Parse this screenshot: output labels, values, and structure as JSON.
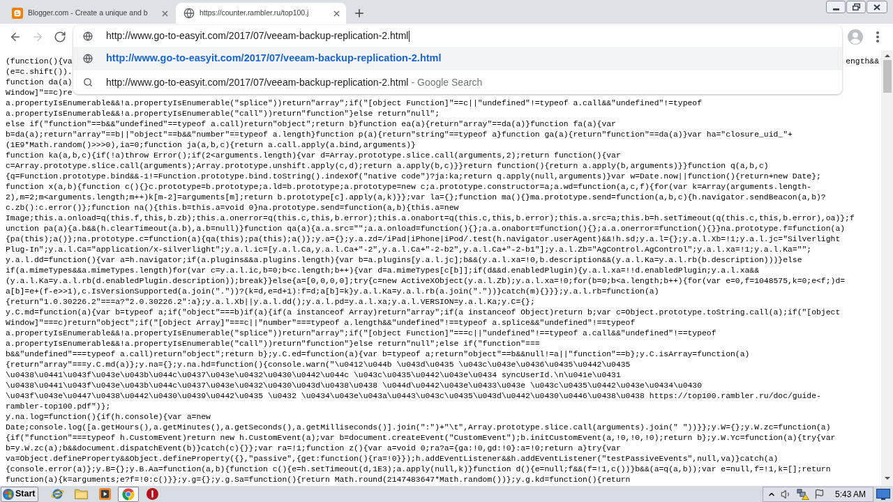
{
  "tabs": [
    {
      "kind": "blog",
      "title": "Blogger.com - Create a unique and b",
      "selected": false
    },
    {
      "kind": "page",
      "title": "https://counter.rambler.ru/top100.j",
      "selected": true
    }
  ],
  "toolbar": {
    "nav": [
      {
        "kind": "back",
        "disabled": false
      },
      {
        "kind": "forward",
        "disabled": true
      },
      {
        "kind": "reload",
        "disabled": false
      }
    ],
    "omnibox": {
      "value": "http://www.go-to-easyit.com/2017/07/veeam-backup-replication-2.html"
    },
    "suggestions": [
      {
        "kind": "url",
        "text": "http://www.go-to-easyit.com/2017/07/veeam-backup-replication-2.html",
        "selected": true
      },
      {
        "kind": "search",
        "text": "http://www.go-to-easyit.com/2017/07/veeam-backup-replication-2.html",
        "suffix": "- Google Search",
        "selected": false
      }
    ]
  },
  "document": {
    "covered_lines": [
      {
        "start": "(function(){va",
        "end": "ength&&"
      },
      {
        "start": "(e=c.shift())."
      },
      {
        "start": "function da(a)"
      },
      {
        "start": "Window]\"==c)re"
      }
    ],
    "lines": [
      "a.propertyIsEnumerable&&!a.propertyIsEnumerable(\"splice\"))return\"array\";if(\"[object Function]\"==c||\"undefined\"!=typeof a.call&&\"undefined\"!=typeof",
      "a.propertyIsEnumerable&&!a.propertyIsEnumerable(\"call\"))return\"function\"}else return\"null\";",
      "else if(\"function\"==b&&\"undefined\"==typeof a.call)return\"object\";return b}function ea(a){return\"array\"==da(a)}function fa(a){var",
      "b=da(a);return\"array\"==b||\"object\"==b&&\"number\"==typeof a.length}function p(a){return\"string\"==typeof a}function ga(a){return\"function\"==da(a)}var ha=\"closure_uid_\"+",
      "(1E9*Math.random()>>>0),ia=0;function ja(a,b,c){return a.call.apply(a.bind,arguments)}",
      "function ka(a,b,c){if(!a)throw Error();if(2<arguments.length){var d=Array.prototype.slice.call(arguments,2);return function(){var",
      "c=Array.prototype.slice.call(arguments);Array.prototype.unshift.apply(c,d);return a.apply(b,c)}}return function(){return a.apply(b,arguments)}}function q(a,b,c)",
      "{q=Function.prototype.bind&&-1!=Function.prototype.bind.toString().indexOf(\"native code\")?ja:ka;return q.apply(null,arguments)}var w=Date.now||function(){return+new Date};",
      "function x(a,b){function c(){}c.prototype=b.prototype;a.ld=b.prototype;a.prototype=new c;a.prototype.constructor=a;a.wd=function(a,c,f){for(var k=Array(arguments.length-",
      "2),m=2;m<arguments.length;m++)k[m-2]=arguments[m];return b.prototype[c].apply(a,k)}};var la={};function ma(){}ma.prototype.send=function(a,b,c){h.navigator.sendBeacon(a,b)?",
      "c.zb():c.error()};function na(){this.b=this.a=void 0}na.prototype.send=function(a,b){this.a=new",
      "Image;this.a.onload=q(this.f,this,b.zb);this.a.onerror=q(this.c,this,b.error);this.a.onabort=q(this.c,this,b.error);this.a.src=a;this.b=h.setTimeout(q(this.c,this,b.error),oa)};f",
      "unction pa(a){a.b&&(h.clearTimeout(a.b),a.b=null)}function qa(a){a.a.src=\"\";a.a.onload=function(){};a.a.onabort=function(){};a.a.onerror=function(){}}na.prototype.f=function(a)",
      "{pa(this);a()};na.prototype.c=function(a){qa(this);pa(this);a()};y.a={};y.a.zd=/iPad|iPhone|iPod/.test(h.navigator.userAgent)&&!h.sd;y.a.l={};y.a.l.Xb=!1;y.a.l.jc=\"Silverlight",
      "Plug-In\";y.a.l.Ca=\"application/x-silverlight\";y.a.l.ic=[y.a.l.Ca,y.a.l.Ca+\"-2\",y.a.l.Ca+\"-2-b2\",y.a.l.Ca+\"-2-b1\"];y.a.l.Zb=\"AgControl.AgControl\";y.a.l.xa=!1;y.a.l.Ka=\"\";",
      "y.a.l.dd=function(){var a=h.navigator;if(a.plugins&&a.plugins.length){var b=a.plugins[y.a.l.jc];b&&(y.a.l.xa=!0,b.description&&(y.a.l.Ka=y.a.l.rb(b.description)))}else",
      "if(a.mimeTypes&&a.mimeTypes.length)for(var c=y.a.l.ic,b=0;b<c.length;b++){var d=a.mimeTypes[c[b]];if(d&&d.enabledPlugin){y.a.l.xa=!!d.enabledPlugin;y.a.l.xa&&",
      "(y.a.l.Ka=y.a.l.rb(d.enabledPlugin.description));break}}else{a=[0,0,0,0];try{c=new ActiveXObject(y.a.l.Zb);y.a.l.xa=!0;for(b=0;b<a.length;b++){for(var e=0,f=1048575,k=0;e<f;)d=",
      "a[b]=e+(f-e>>1),c.IsVersionSupported(a.join(\".\"))?(k=d,e=d+1):f=d;a[b]=k}y.a.l.Ka=y.a.l.rb(a.join(\".\"))}catch(m){}}};y.a.l.rb=function(a)",
      "{return\"1.0.30226.2\"===a?\"2.0.30226.2\":a};y.a.l.Xb||y.a.l.dd();y.a.l.pd=y.a.l.xa;y.a.l.VERSION=y.a.l.Ka;y.C={};",
      "y.C.md=function(a){var b=typeof a;if(\"object\"===b)if(a){if(a instanceof Array)return\"array\";if(a instanceof Object)return b;var c=Object.prototype.toString.call(a);if(\"[object",
      "Window]\"===c)return\"object\";if(\"[object Array]\"===c||\"number\"===typeof a.length&&\"undefined\"!==typeof a.splice&&\"undefined\"!==typeof",
      "a.propertyIsEnumerable&&!a.propertyIsEnumerable(\"splice\"))return\"array\";if(\"[object Function]\"===c||\"undefined\"!==typeof a.call&&\"undefined\"!==typeof",
      "a.propertyIsEnumerable&&!a.propertyIsEnumerable(\"call\"))return\"function\"}else return\"null\";else if(\"function\"===",
      "b&&\"undefined\"===typeof a.call)return\"object\";return b};y.C.ed=function(a){var b=typeof a;return\"object\"==b&&null!=a||\"function\"==b};y.C.isArray=function(a)",
      "{return\"array\"===y.C.md(a)};y.na={};y.na.hd=function(){console.warn(\"\\u0412\\u044b \\u043d\\u0435 \\u043c\\u043e\\u0436\\u0435\\u0442\\u0435",
      "\\u0438\\u0441\\u043f\\u043e\\u043b\\u044c\\u0437\\u043e\\u0432\\u0430\\u0442\\u044c \\u043c\\u0435\\u0442\\u043e\\u0434 syncUserId.\\n\\u041e\\u0431",
      "\\u0438\\u0441\\u043f\\u043e\\u043b\\u044c\\u0437\\u043e\\u0432\\u0430\\u043d\\u0438\\u0438 \\u044d\\u0442\\u043e\\u0433\\u043e \\u043c\\u0435\\u0442\\u043e\\u0434\\u0430",
      "\\u043f\\u043e\\u0447\\u0438\\u0442\\u0430\\u0439\\u0442\\u0435 \\u0432 \\u0434\\u043e\\u043a\\u0443\\u043c\\u0435\\u043d\\u0442\\u0430\\u0446\\u0438\\u0438 https://top100.rambler.ru/doc/guide-",
      "rambler-top100.pdf\")};",
      "y.na.log=function(){if(h.console){var a=new",
      "Date;console.log([a.getHours(),a.getMinutes(),a.getSeconds(),a.getMilliseconds()].join(\":\")+\"\\t\",Array.prototype.slice.call(arguments).join(\" \"))}};y.W={};y.W.zc=function(a)",
      "{if(\"function\"===typeof h.CustomEvent)return new h.CustomEvent(a);var b=document.createEvent(\"CustomEvent\");b.initCustomEvent(a,!0,!0,!0);return b};y.W.Yc=function(a){try{var",
      "b=y.W.zc(a);b&&document.dispatchEvent(b)}catch(c){}};var ra=!1;function z(){var a=void 0;ra?a={ga:!0,gd:!0}:a=!0;return a}try{var",
      "va=Object.defineProperty&&Object.defineProperty({},\"passive\",{get:function(){ra=!0}});h.addEventListener&&h.addEventListener(\"testPassiveEvents\",null,va)}catch(a)",
      "{console.error(a)};y.B={};y.B.Aa=function(a,b){function c(){e=h.setTimeout(d,1E3);a.apply(null,k)}function d(){e=null;f&&(f=!1,c())}b&&(a=q(a,b));var e=null,f=!1,k=[];return",
      "function(a){k=arguments;e?f=!0:c()}};y.g={};y.g.Sa=function(){return Math.round(2147483647*Math.random())};y.g.kd=function(){return"
    ]
  },
  "taskbar": {
    "start": "Start",
    "apps": [
      {
        "kind": "ie",
        "selected": false
      },
      {
        "kind": "folder",
        "selected": false
      },
      {
        "kind": "media",
        "selected": false
      },
      {
        "kind": "chrome",
        "selected": true
      },
      {
        "kind": "alert",
        "selected": false
      }
    ],
    "clock": "5:43 AM"
  }
}
